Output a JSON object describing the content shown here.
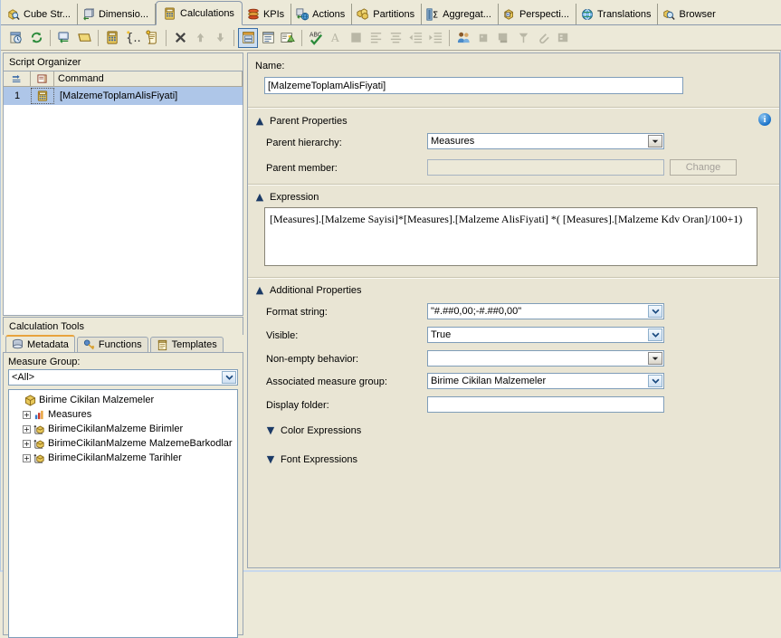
{
  "tabs": [
    {
      "label": "Cube Str...",
      "icon": "cube-search-icon",
      "active": false
    },
    {
      "label": "Dimensio...",
      "icon": "dimension-icon",
      "active": false
    },
    {
      "label": "Calculations",
      "icon": "calculator-icon",
      "active": true
    },
    {
      "label": "KPIs",
      "icon": "kpi-icon",
      "active": false
    },
    {
      "label": "Actions",
      "icon": "actions-icon",
      "active": false
    },
    {
      "label": "Partitions",
      "icon": "partitions-icon",
      "active": false
    },
    {
      "label": "Aggregat...",
      "icon": "aggregations-icon",
      "active": false
    },
    {
      "label": "Perspecti...",
      "icon": "perspectives-icon",
      "active": false
    },
    {
      "label": "Translations",
      "icon": "translations-icon",
      "active": false
    },
    {
      "label": "Browser",
      "icon": "browser-search-icon",
      "active": false
    }
  ],
  "toolbar": {
    "buttons": [
      {
        "name": "new-calculated-member-icon",
        "enabled": true
      },
      {
        "name": "refresh-icon",
        "enabled": true
      },
      {
        "name": "sep",
        "enabled": true
      },
      {
        "name": "new-script-command-icon",
        "enabled": true
      },
      {
        "name": "new-named-set-icon",
        "enabled": true
      },
      {
        "name": "sep",
        "enabled": true
      },
      {
        "name": "new-calculation-icon",
        "enabled": true
      },
      {
        "name": "new-set-braces-icon",
        "enabled": true
      },
      {
        "name": "new-script-icon",
        "enabled": true
      },
      {
        "name": "sep",
        "enabled": true
      },
      {
        "name": "delete-icon",
        "enabled": true
      },
      {
        "name": "move-up-icon",
        "enabled": false
      },
      {
        "name": "move-down-icon",
        "enabled": false
      },
      {
        "name": "sep",
        "enabled": true
      },
      {
        "name": "form-view-icon",
        "enabled": true,
        "selected": true
      },
      {
        "name": "script-view-icon",
        "enabled": true
      },
      {
        "name": "calculation-properties-icon",
        "enabled": true
      },
      {
        "name": "sep",
        "enabled": true
      },
      {
        "name": "spell-check-icon",
        "enabled": true
      },
      {
        "name": "font-icon",
        "enabled": false
      },
      {
        "name": "color-icon",
        "enabled": false
      },
      {
        "name": "align-left-icon",
        "enabled": false
      },
      {
        "name": "align-center-icon",
        "enabled": false
      },
      {
        "name": "decrease-indent-icon",
        "enabled": false
      },
      {
        "name": "increase-indent-icon",
        "enabled": false
      },
      {
        "name": "sep",
        "enabled": true
      },
      {
        "name": "roles-icon",
        "enabled": true
      },
      {
        "name": "process-icon",
        "enabled": false
      },
      {
        "name": "deploy-icon",
        "enabled": false
      },
      {
        "name": "pin-icon",
        "enabled": false
      },
      {
        "name": "attach-icon",
        "enabled": false
      },
      {
        "name": "properties-icon",
        "enabled": false
      }
    ]
  },
  "script_organizer": {
    "title": "Script Organizer",
    "columns": [
      "",
      "",
      "Command"
    ],
    "rows": [
      {
        "num": "1",
        "icon": "calculation-row-icon",
        "command": "[MalzemeToplamAlisFiyati]",
        "selected": true
      }
    ]
  },
  "calculation_tools": {
    "title": "Calculation Tools",
    "tabs": [
      {
        "label": "Metadata",
        "icon": "metadata-cube-icon",
        "active": true
      },
      {
        "label": "Functions",
        "icon": "functions-icon",
        "active": false
      },
      {
        "label": "Templates",
        "icon": "templates-icon",
        "active": false
      }
    ],
    "measure_group_label": "Measure Group:",
    "measure_group_value": "<All>",
    "tree": [
      {
        "label": "Birime Cikilan Malzemeler",
        "icon": "cube-icon",
        "level": 0,
        "expandable": false
      },
      {
        "label": "Measures",
        "icon": "measures-icon",
        "level": 1,
        "expandable": true
      },
      {
        "label": "BirimeCikilanMalzeme Birimler",
        "icon": "dimension-axes-icon",
        "level": 1,
        "expandable": true
      },
      {
        "label": "BirimeCikilanMalzeme MalzemeBarkodlar",
        "icon": "dimension-axes-icon",
        "level": 1,
        "expandable": true
      },
      {
        "label": "BirimeCikilanMalzeme Tarihler",
        "icon": "dimension-axes-icon",
        "level": 1,
        "expandable": true
      }
    ]
  },
  "details": {
    "name_label": "Name:",
    "name_value": "[MalzemeToplamAlisFiyati]",
    "parent_properties": {
      "title": "Parent Properties",
      "parent_hierarchy_label": "Parent hierarchy:",
      "parent_hierarchy_value": "Measures",
      "parent_member_label": "Parent member:",
      "parent_member_value": "",
      "change_button": "Change"
    },
    "expression": {
      "title": "Expression",
      "value": "[Measures].[Malzeme Sayisi]*[Measures].[Malzeme AlisFiyati] *( [Measures].[Malzeme Kdv Oran]/100+1)"
    },
    "additional_properties": {
      "title": "Additional Properties",
      "format_string_label": "Format string:",
      "format_string_value": "\"#.##0,00;-#.##0,00\"",
      "visible_label": "Visible:",
      "visible_value": "True",
      "non_empty_label": "Non-empty behavior:",
      "non_empty_value": "",
      "assoc_measure_group_label": "Associated measure group:",
      "assoc_measure_group_value": "Birime Cikilan Malzemeler",
      "display_folder_label": "Display folder:",
      "display_folder_value": ""
    },
    "color_expressions_title": "Color Expressions",
    "font_expressions_title": "Font Expressions",
    "info_icon": "info-icon"
  },
  "colors": {
    "window_bg": "#ece9d8",
    "panel_bg": "#e9e5d4",
    "selection": "#aec6e8",
    "accent_tab": "#e8a33d",
    "border": "#9aa6b4"
  }
}
